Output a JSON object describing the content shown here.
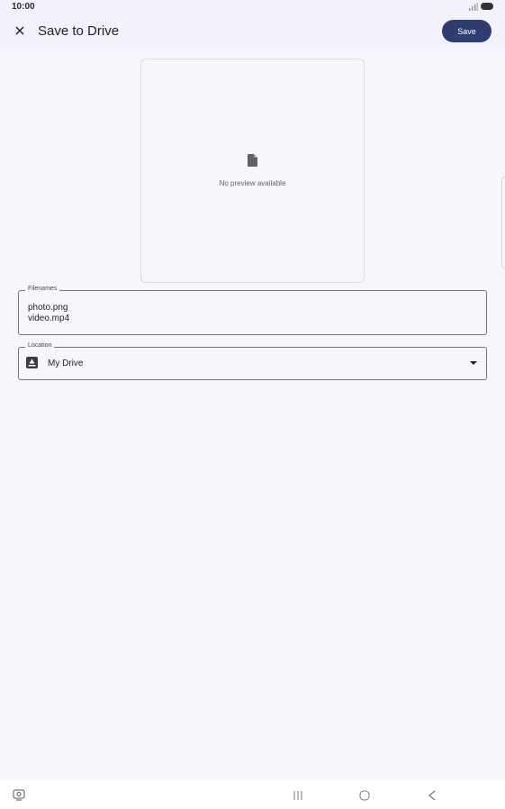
{
  "status_bar": {
    "time": "10:00",
    "icons": [
      "signal-icon",
      "battery-icon"
    ]
  },
  "app_bar": {
    "title": "Save to Drive",
    "save_label": "Save",
    "close_icon": "close-icon"
  },
  "preview": {
    "message": "No preview available",
    "icon": "file-icon"
  },
  "filenames": {
    "label": "Filenames",
    "files": [
      "photo.png",
      "video.mp4"
    ]
  },
  "location": {
    "label": "Location",
    "value": "My Drive",
    "icon": "drive-icon"
  },
  "nav_bar": {
    "icons": [
      "screen-record-icon",
      "recent-apps-icon",
      "home-icon",
      "back-icon"
    ]
  },
  "colors": {
    "background": "#f7f6fc",
    "app_bar": "#f3f1fa",
    "accent": "#2d3d6f",
    "outline": "#77767d"
  }
}
